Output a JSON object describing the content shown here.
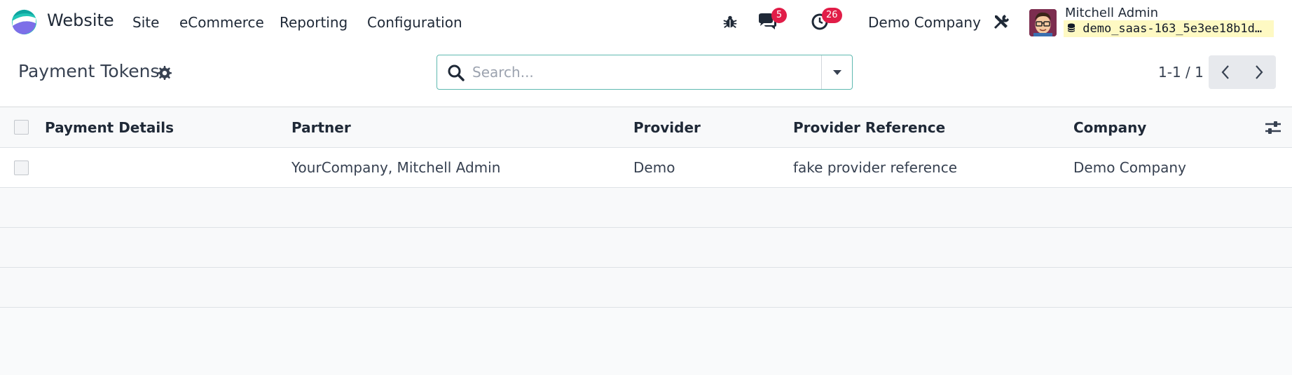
{
  "navbar": {
    "app_name": "Website",
    "menu": [
      "Site",
      "eCommerce",
      "Reporting",
      "Configuration"
    ],
    "messages_count": "5",
    "activities_count": "26",
    "company": "Demo Company",
    "user_name": "Mitchell Admin",
    "database": "demo_saas-163_5e3ee18b1d…",
    "accent_color": "#e11d48",
    "icons": [
      "bug-icon",
      "chat-icon",
      "clock-icon",
      "tools-icon",
      "database-icon"
    ]
  },
  "control_panel": {
    "title": "Payment Tokens",
    "search_placeholder": "Search...",
    "pager": "1-1 / 1"
  },
  "table": {
    "columns": [
      "Payment Details",
      "Partner",
      "Provider",
      "Provider Reference",
      "Company"
    ],
    "rows": [
      {
        "payment_details": "",
        "partner": "YourCompany, Mitchell Admin",
        "provider": "Demo",
        "provider_reference": "fake provider reference",
        "company": "Demo Company"
      }
    ]
  }
}
